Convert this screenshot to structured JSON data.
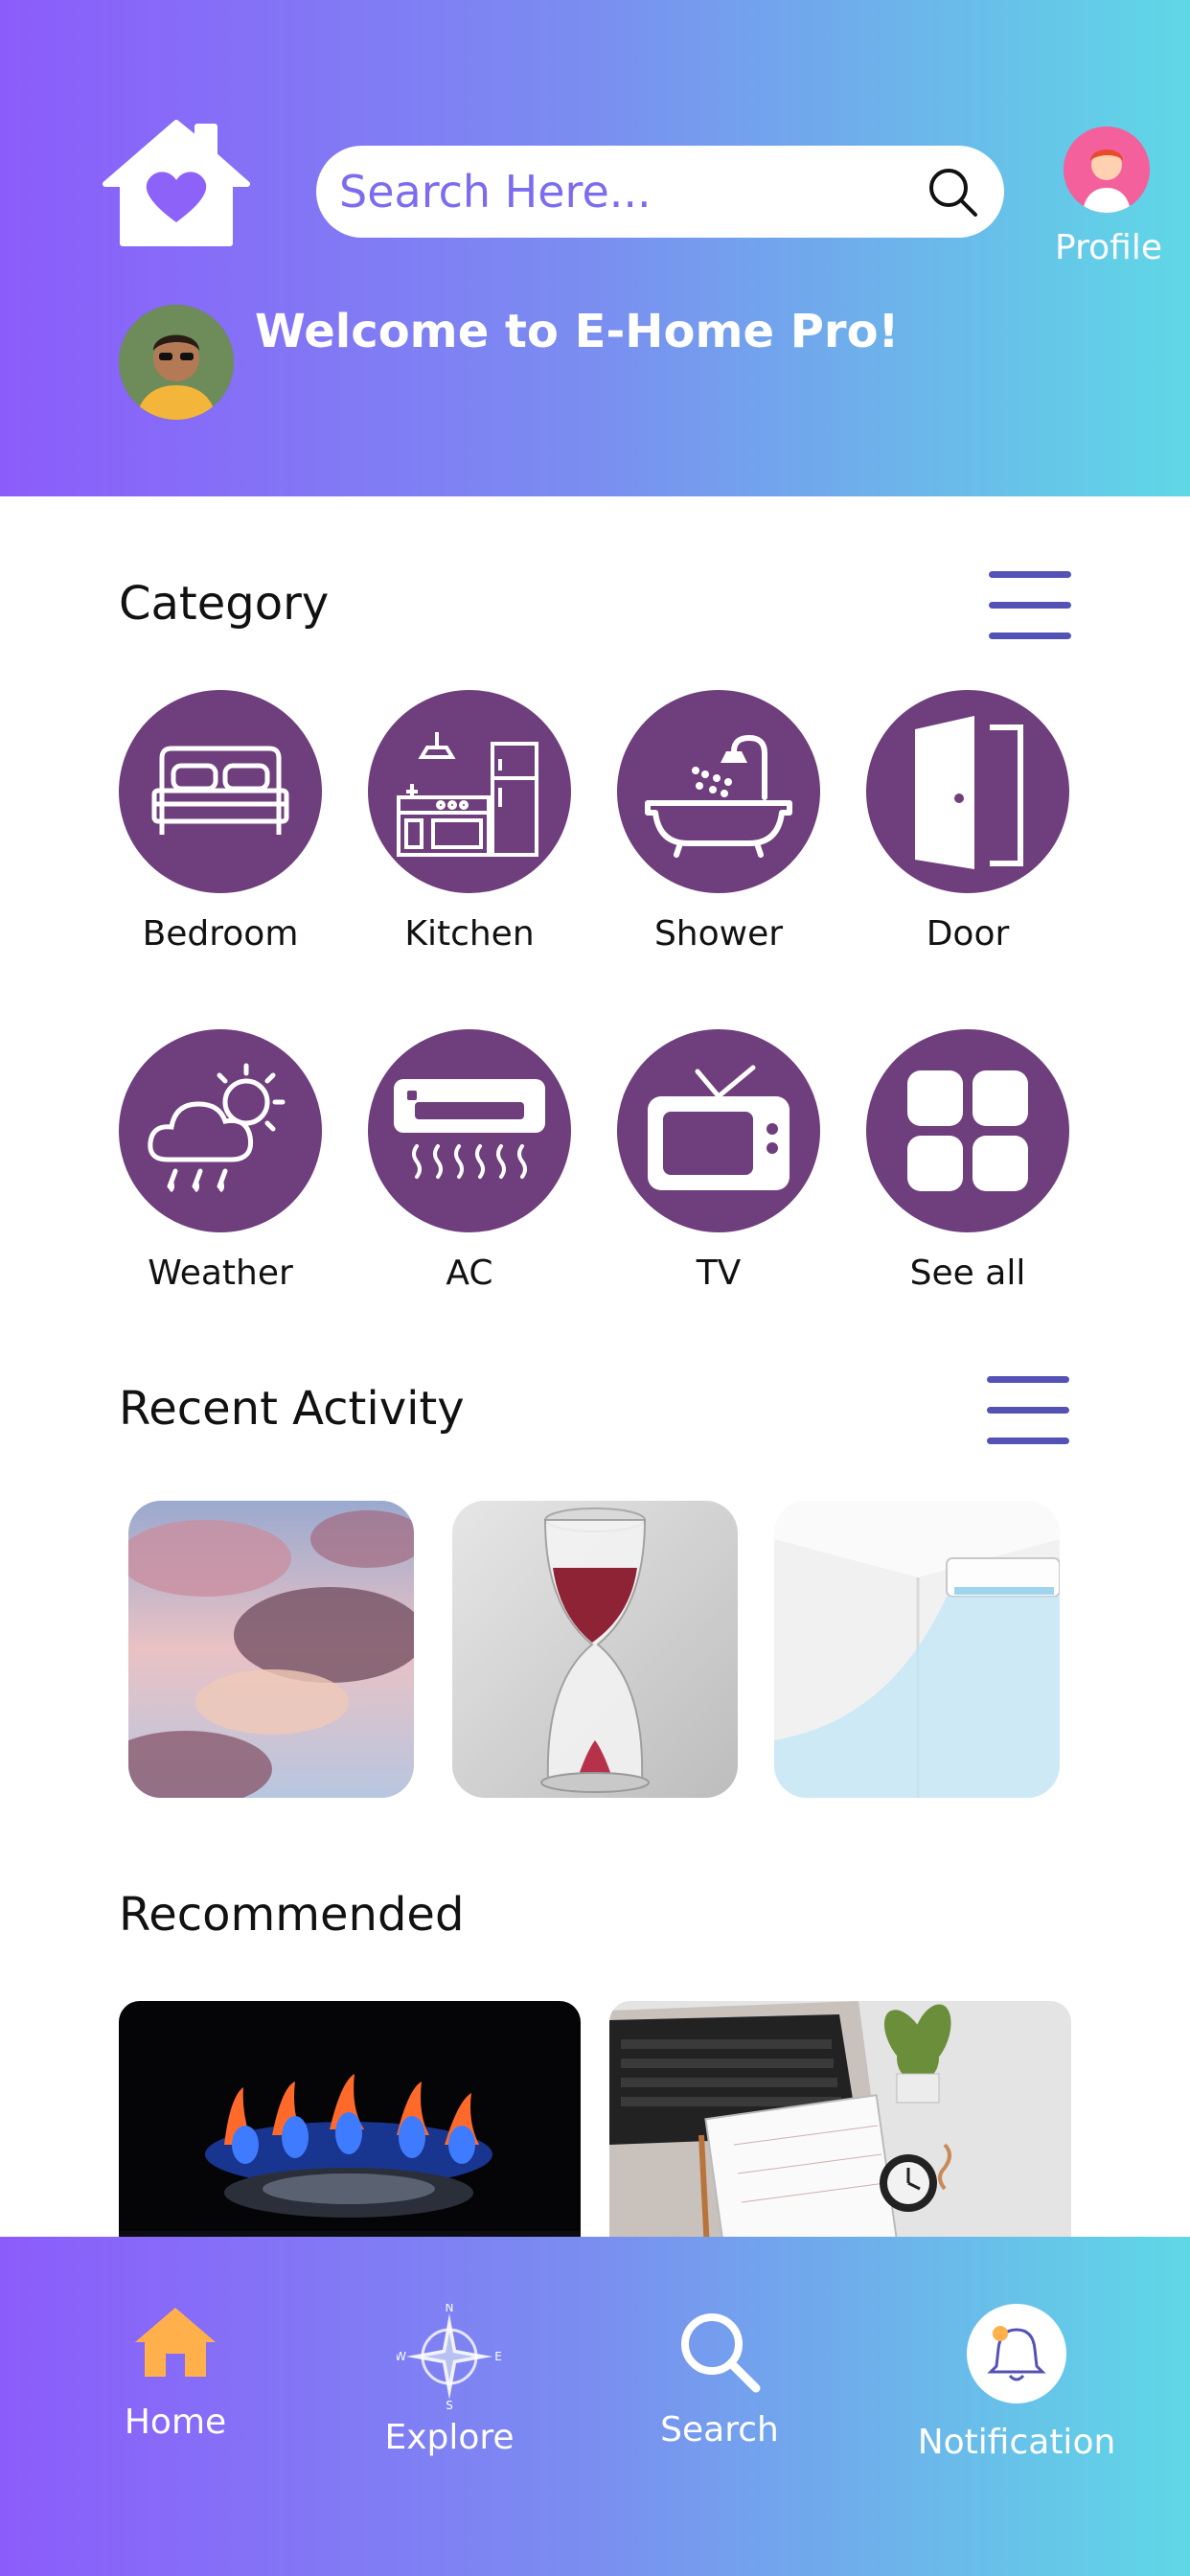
{
  "header": {
    "search": {
      "placeholder": "Search Here..."
    },
    "profile_label": "Profile",
    "welcome": "Welcome to E-Home Pro!"
  },
  "category": {
    "title": "Category",
    "items": [
      {
        "label": "Bedroom",
        "icon": "bed-icon"
      },
      {
        "label": "Kitchen",
        "icon": "kitchen-icon"
      },
      {
        "label": "Shower",
        "icon": "shower-icon"
      },
      {
        "label": "Door",
        "icon": "door-icon"
      },
      {
        "label": "Weather",
        "icon": "weather-icon"
      },
      {
        "label": "AC",
        "icon": "ac-icon"
      },
      {
        "label": "TV",
        "icon": "tv-icon"
      },
      {
        "label": "See all",
        "icon": "grid-icon"
      }
    ]
  },
  "recent_activity": {
    "title": "Recent Activity",
    "items": [
      "cloudy-sky-photo",
      "hourglass-photo",
      "air-conditioner-photo"
    ]
  },
  "recommended": {
    "title": "Recommended",
    "items": [
      "gas-flame-photo",
      "laptop-calendar-photo"
    ]
  },
  "bottom_nav": {
    "items": [
      {
        "label": "Home",
        "icon": "home-icon",
        "active": true
      },
      {
        "label": "Explore",
        "icon": "compass-icon"
      },
      {
        "label": "Search",
        "icon": "search-icon"
      },
      {
        "label": "Notification",
        "icon": "bell-icon"
      }
    ]
  },
  "colors": {
    "gradient_start": "#8c5cfb",
    "gradient_end": "#5fd8e6",
    "category_circle": "#6f3f7d",
    "menu_lines": "#5552b6",
    "home_active": "#ffb04a"
  }
}
